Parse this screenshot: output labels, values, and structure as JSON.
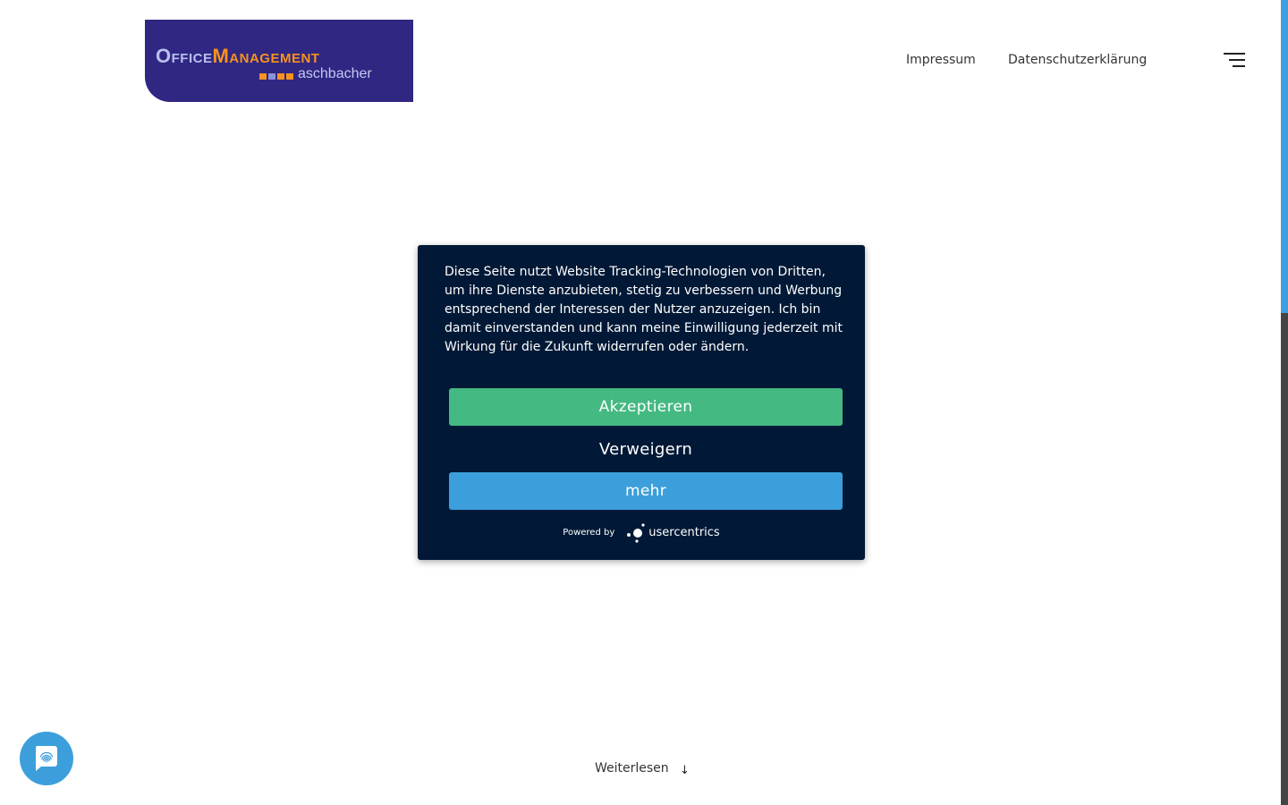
{
  "header": {
    "logo": {
      "word1": "Office",
      "word2": "Management",
      "subtitle": "aschbacher"
    },
    "nav": [
      {
        "label": "Impressum"
      },
      {
        "label": "Datenschutzerklärung"
      }
    ]
  },
  "consent": {
    "text": "Diese Seite nutzt Website Tracking-Technologien von Dritten, um ihre Dienste anzubieten, stetig zu verbessern und Werbung entsprechend der Interessen der Nutzer anzuzeigen. Ich bin damit einverstanden und kann meine Einwilligung jederzeit mit Wirkung für die Zukunft widerrufen oder ändern.",
    "accept_label": "Akzeptieren",
    "deny_label": "Verweigern",
    "more_label": "mehr",
    "powered_by": "Powered by",
    "brand": "usercentrics"
  },
  "footer": {
    "read_more": "Weiterlesen",
    "arrow": "↓"
  },
  "colors": {
    "logo_bg": "#302783",
    "logo_accent": "#f7931e",
    "dialog_bg": "#011936",
    "accept": "#44b982",
    "more": "#3c9fdb",
    "scroll_thumb": "#3c9fe0"
  },
  "icons": {
    "menu": "hamburger-menu-icon",
    "privacy": "fingerprint-icon"
  }
}
